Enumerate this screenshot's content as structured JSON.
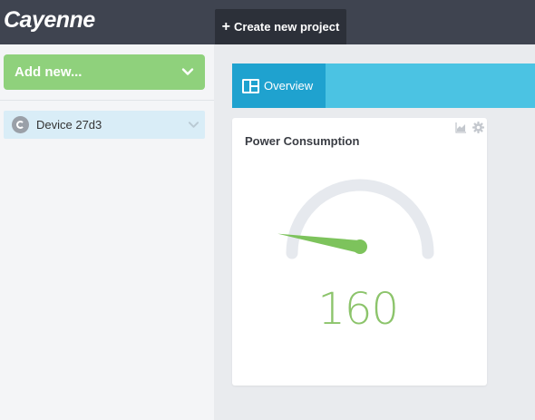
{
  "app": {
    "title": "Cayenne"
  },
  "header": {
    "create_label": "Create new project"
  },
  "sidebar": {
    "add_new_label": "Add new...",
    "devices": [
      {
        "label": "Device 27d3"
      }
    ]
  },
  "tabs": [
    {
      "label": "Overview",
      "active": true
    }
  ],
  "widget": {
    "title": "Power Consumption",
    "value": "160",
    "gauge_fraction": 0.05,
    "colors": {
      "value": "#8cc46b",
      "track": "#e6e9ee",
      "needle": "#7dc35c"
    }
  },
  "colors": {
    "topbar": "#3f4450",
    "accent_green": "#8fd17c",
    "tab_bar": "#4bc3e3",
    "tab_active": "#1fa2cf",
    "device_selected": "#d9edf7"
  },
  "icons": {
    "create": "plus-icon",
    "add_new": "chevron-down-icon",
    "device": "cayenne-device-icon",
    "overview": "dashboard-icon",
    "widget_chart": "area-chart-icon",
    "widget_settings": "gear-icon"
  }
}
